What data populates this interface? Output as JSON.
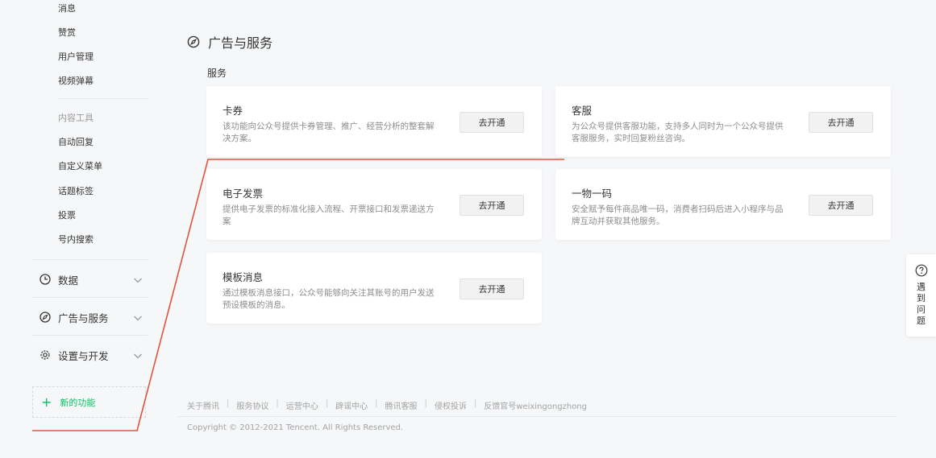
{
  "sidebar": {
    "items_top": [
      {
        "id": "messages",
        "label": "消息"
      },
      {
        "id": "rewards",
        "label": "赞赏"
      },
      {
        "id": "users",
        "label": "用户管理"
      },
      {
        "id": "video-danmaku",
        "label": "视频弹幕"
      }
    ],
    "tools_heading": "内容工具",
    "tools": [
      {
        "id": "auto-reply",
        "label": "自动回复"
      },
      {
        "id": "custom-menu",
        "label": "自定义菜单"
      },
      {
        "id": "topic-tags",
        "label": "话题标签"
      },
      {
        "id": "vote",
        "label": "投票"
      },
      {
        "id": "in-account-search",
        "label": "号内搜索"
      }
    ],
    "groups": [
      {
        "id": "data",
        "label": "数据",
        "icon": "clock-icon"
      },
      {
        "id": "ads-services",
        "label": "广告与服务",
        "icon": "compass-icon"
      },
      {
        "id": "settings-dev",
        "label": "设置与开发",
        "icon": "gear-icon"
      }
    ],
    "new_features": "新的功能"
  },
  "page": {
    "title": "广告与服务",
    "section": "服务",
    "open_label": "去开通",
    "cards": [
      {
        "id": "card-coupons",
        "title": "卡券",
        "desc": "该功能向公众号提供卡券管理、推广、经营分析的整套解决方案。"
      },
      {
        "id": "card-customer-service",
        "title": "客服",
        "desc": "为公众号提供客服功能，支持多人同时为一个公众号提供客服服务，实时回复粉丝咨询。"
      },
      {
        "id": "card-e-invoice",
        "title": "电子发票",
        "desc": "提供电子发票的标准化接入流程、开票接口和发票递送方案"
      },
      {
        "id": "card-one-code",
        "title": "一物一码",
        "desc": "安全赋予每件商品唯一码，消费者扫码后进入小程序与品牌互动并获取其他服务。"
      },
      {
        "id": "card-template-msg",
        "title": "模板消息",
        "desc": "通过模板消息接口，公众号能够向关注其账号的用户发送预设模板的消息。"
      }
    ]
  },
  "footer": {
    "links": [
      "关于腾讯",
      "服务协议",
      "运营中心",
      "辟谣中心",
      "腾讯客服",
      "侵权投诉",
      "反馈官号weixingongzhong"
    ],
    "separator": "|",
    "copyright": "Copyright © 2012-2021 Tencent. All Rights Reserved."
  },
  "help": {
    "label": "遇到问题"
  },
  "colors": {
    "accent_green": "#07c160",
    "annotation_red": "#e0533f"
  }
}
